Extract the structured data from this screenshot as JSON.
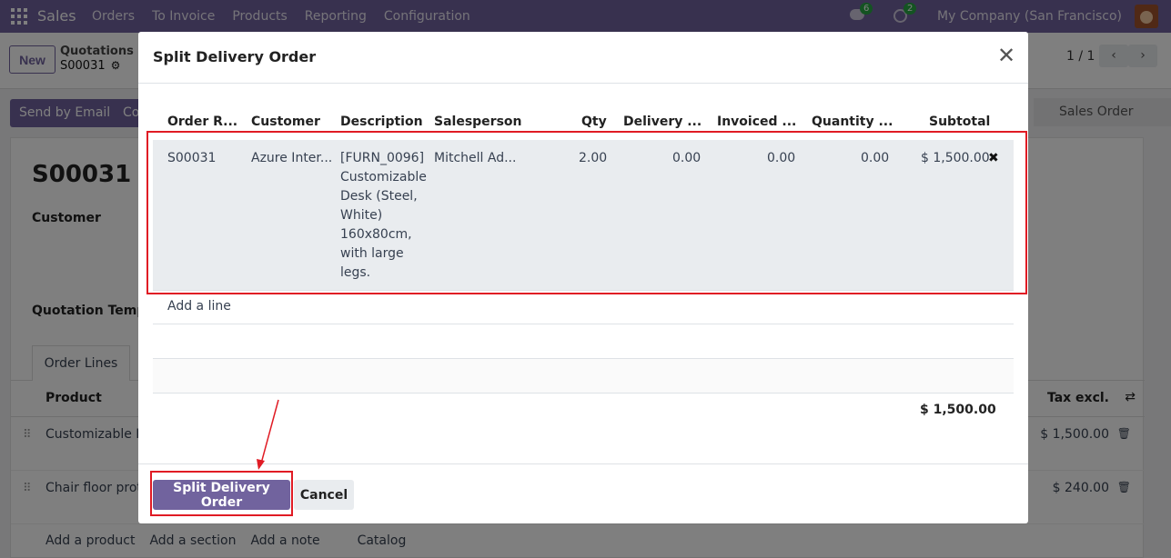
{
  "navbar": {
    "app_name": "Sales",
    "menu": [
      "Orders",
      "To Invoice",
      "Products",
      "Reporting",
      "Configuration"
    ],
    "messages_count": "6",
    "activities_count": "2",
    "company": "My Company (San Francisco)"
  },
  "control": {
    "new_label": "New",
    "breadcrumb_parent": "Quotations",
    "breadcrumb_current": "S00031",
    "pager": "1 / 1"
  },
  "actions": {
    "send_email": "Send by Email",
    "partial_button": "Co",
    "stage": "Sales Order"
  },
  "form": {
    "name": "S00031",
    "customer_label": "Customer",
    "template_label": "Quotation Templa",
    "tab_order_lines": "Order Lines",
    "col_product": "Product",
    "col_tax_excl": "Tax excl.",
    "lines": [
      {
        "product": "Customizable De",
        "amount": "$ 1,500.00"
      },
      {
        "product": "Chair floor prote",
        "amount": "$ 240.00"
      }
    ],
    "add_product": "Add a product",
    "add_section": "Add a section",
    "add_note": "Add a note",
    "catalog": "Catalog"
  },
  "modal": {
    "title": "Split Delivery Order",
    "columns": [
      "Order R...",
      "Customer",
      "Description",
      "Salesperson",
      "Qty",
      "Delivery ...",
      "Invoiced ...",
      "Quantity ...",
      "Subtotal"
    ],
    "row": {
      "order_ref": "S00031",
      "customer": "Azure Inter...",
      "description": "[FURN_0096] Customizable Desk (Steel, White) 160x80cm, with large legs.",
      "salesperson": "Mitchell Ad...",
      "qty": "2.00",
      "delivered": "0.00",
      "invoiced": "0.00",
      "quantity": "0.00",
      "subtotal": "$ 1,500.00"
    },
    "add_line": "Add a line",
    "total": "$ 1,500.00",
    "split_button": "Split Delivery Order",
    "cancel_button": "Cancel"
  },
  "colors": {
    "brand": "#71639e",
    "highlight": "#e01b24"
  }
}
